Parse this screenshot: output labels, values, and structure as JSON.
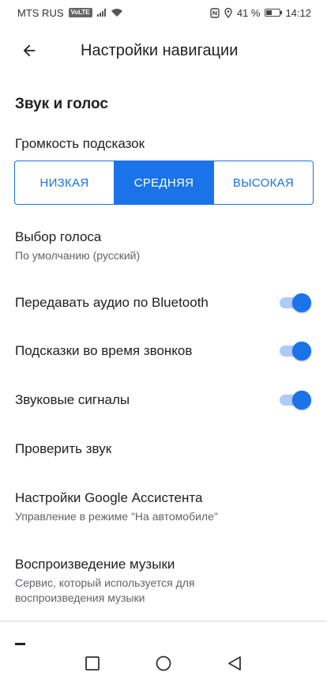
{
  "status_bar": {
    "carrier": "MTS RUS",
    "volte": "VoLTE",
    "battery_text": "41 %",
    "battery_level": 0.41,
    "time": "14:12"
  },
  "header": {
    "title": "Настройки навигации",
    "back_icon": "arrow-back-icon"
  },
  "section": {
    "title": "Звук и голос"
  },
  "volume": {
    "label": "Громкость подсказок",
    "options": [
      "НИЗКАЯ",
      "СРЕДНЯЯ",
      "ВЫСОКАЯ"
    ],
    "selected": "СРЕДНЯЯ"
  },
  "settings": {
    "voice": {
      "label": "Выбор голоса",
      "sub": "По умолчанию (русский)"
    },
    "bluetooth": {
      "label": "Передавать аудио по Bluetooth",
      "on": true
    },
    "calls": {
      "label": "Подсказки во время звонков",
      "on": true
    },
    "sounds": {
      "label": "Звуковые сигналы",
      "on": true
    },
    "test_sound": {
      "label": "Проверить звук"
    },
    "assistant": {
      "label": "Настройки Google Ассистента",
      "sub": "Управление в режиме \"На автомобиле\""
    },
    "music": {
      "label": "Воспроизведение музыки",
      "sub": "Сервис, который используется для воспроизведения музыки"
    }
  },
  "colors": {
    "accent": "#1a73e8",
    "track": "#aecbfa",
    "text_primary": "#202124",
    "text_secondary": "#5f6368"
  },
  "nav_bar": {
    "icons": [
      "square-recents-icon",
      "circle-home-icon",
      "triangle-back-icon"
    ]
  }
}
